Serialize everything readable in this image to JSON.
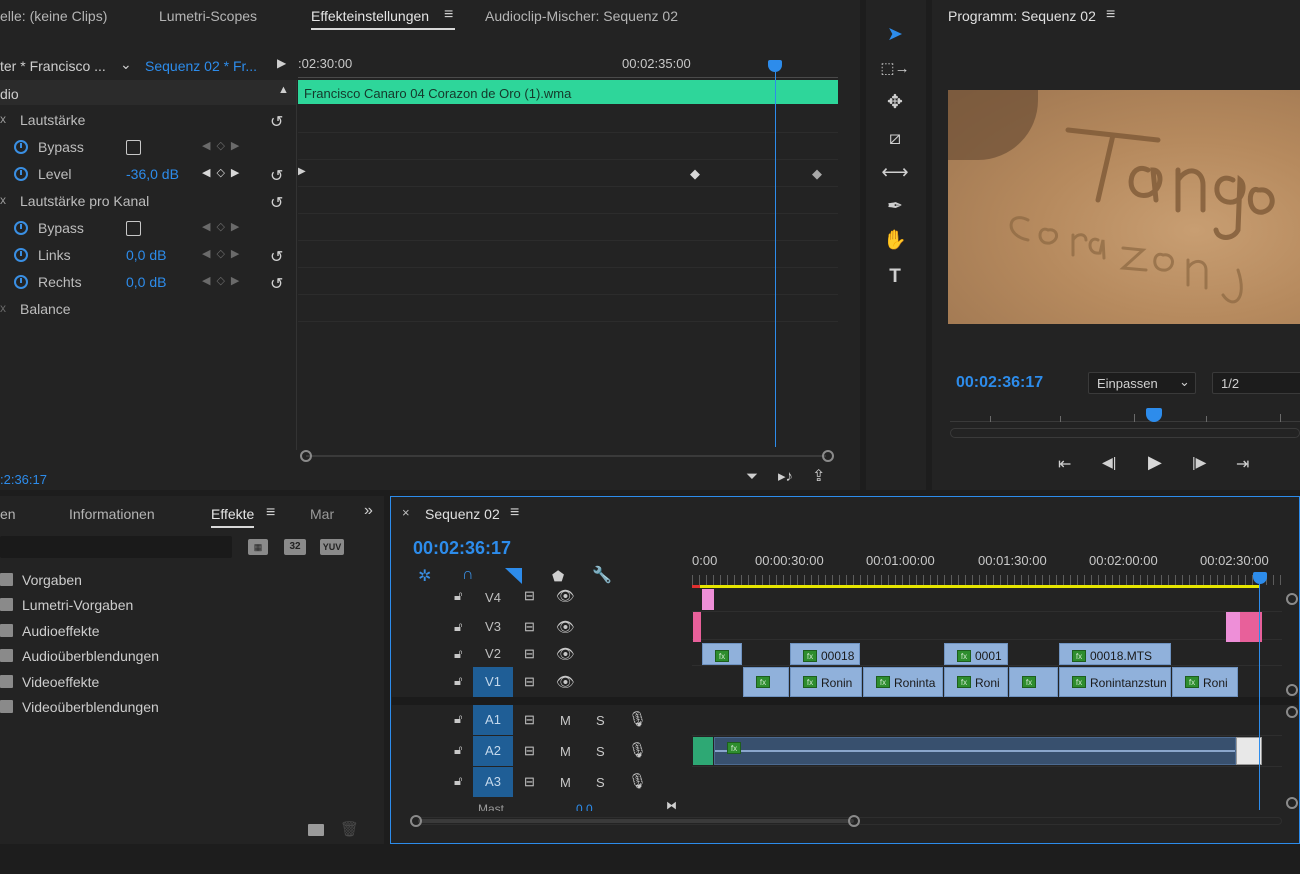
{
  "effect_controls": {
    "tabs": [
      "elle: (keine Clips)",
      "Lumetri-Scopes",
      "Effekteinstellungen",
      "Audioclip-Mischer: Sequenz 02"
    ],
    "master_label": "ter * Francisco ...",
    "sequence_label": "Sequenz 02 * Fr...",
    "time_left": ":02:30:00",
    "time_right": "00:02:35:00",
    "clip_name": "Francisco Canaro 04 Corazon de Oro (1).wma",
    "section": "dio",
    "rows": {
      "volume": "Lautstärke",
      "bypass": "Bypass",
      "level": "Level",
      "level_value": "-36,0 dB",
      "channel_volume": "Lautstärke pro Kanal",
      "bypass2": "Bypass",
      "left": "Links",
      "left_value": "0,0 dB",
      "right": "Rechts",
      "right_value": "0,0 dB",
      "balance": "Balance"
    },
    "timecode": ":2:36:17"
  },
  "program_monitor": {
    "title": "Programm: Sequenz 02",
    "timecode": "00:02:36:17",
    "zoom": "Einpassen",
    "resolution": "1/2"
  },
  "effects_panel": {
    "tabs": [
      "en",
      "Informationen",
      "Effekte",
      "Mar"
    ],
    "badges": [
      "32",
      "YUV"
    ],
    "items": [
      "Vorgaben",
      "Lumetri-Vorgaben",
      "Audioeffekte",
      "Audioüberblendungen",
      "Videoeffekte",
      "Videoüberblendungen"
    ]
  },
  "timeline": {
    "title": "Sequenz 02",
    "timecode": "00:02:36:17",
    "ruler": [
      "0:00",
      "00:00:30:00",
      "00:01:00:00",
      "00:01:30:00",
      "00:02:00:00",
      "00:02:30:00"
    ],
    "tracks": [
      "V4",
      "V3",
      "V2",
      "V1",
      "A1",
      "A2",
      "A3"
    ],
    "mute": "M",
    "solo": "S",
    "clips_v2": [
      "00018",
      "0001",
      "00018.MTS"
    ],
    "clips_v1": [
      "",
      "Ronin",
      "Roninta",
      "Roni",
      "",
      "Ronintanzstun",
      "Roni"
    ],
    "master_label": "Mast",
    "master_value": "0,0"
  },
  "colors": {
    "accent": "#2d8ceb",
    "audio_clip": "#2ed69a",
    "video_clip": "#90b1db",
    "pink_clip": "#e8609a"
  }
}
